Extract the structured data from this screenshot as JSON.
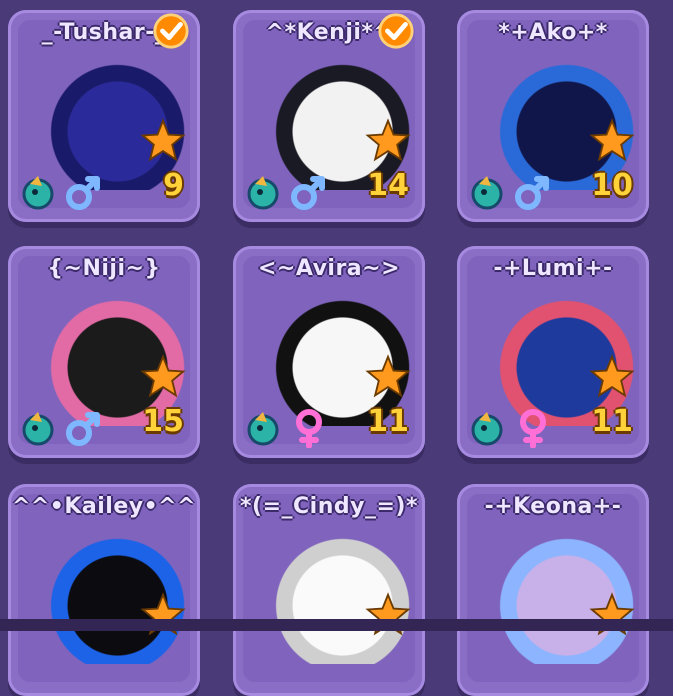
{
  "pets": [
    {
      "name": "_-Tushar-_",
      "age": "9",
      "gender": "male",
      "verified": true,
      "art": "#2a2a9a",
      "art2": "#1a1a6a"
    },
    {
      "name": "^*Kenji*^",
      "age": "14",
      "gender": "male",
      "verified": true,
      "art": "#f2f2f2",
      "art2": "#1a1a24"
    },
    {
      "name": "*+Ako+*",
      "age": "10",
      "gender": "male",
      "verified": false,
      "art": "#10164a",
      "art2": "#2a6ad8"
    },
    {
      "name": "{~Niji~}",
      "age": "15",
      "gender": "male",
      "verified": false,
      "art": "#1b1b1b",
      "art2": "#e26ba5"
    },
    {
      "name": "<~Avira~>",
      "age": "11",
      "gender": "female",
      "verified": false,
      "art": "#f7f7f7",
      "art2": "#111111"
    },
    {
      "name": "-+Lumi+-",
      "age": "11",
      "gender": "female",
      "verified": false,
      "art": "#1f3a9d",
      "art2": "#e05270"
    },
    {
      "name": "^^•Kailey•^^",
      "age": "",
      "gender": "",
      "verified": false,
      "art": "#0c0c10",
      "art2": "#1d63e8"
    },
    {
      "name": "*(=_Cindy_=)*",
      "age": "",
      "gender": "",
      "verified": false,
      "art": "#fafafa",
      "art2": "#cfcfcf"
    },
    {
      "name": "-+Keona+-",
      "age": "",
      "gender": "",
      "verified": false,
      "art": "#c8b0e8",
      "art2": "#8cb4ff"
    }
  ],
  "colors": {
    "star": "#ff9a1f",
    "male": "#7fb7ff",
    "female": "#ff6fd6",
    "check": "#ff8a00"
  }
}
